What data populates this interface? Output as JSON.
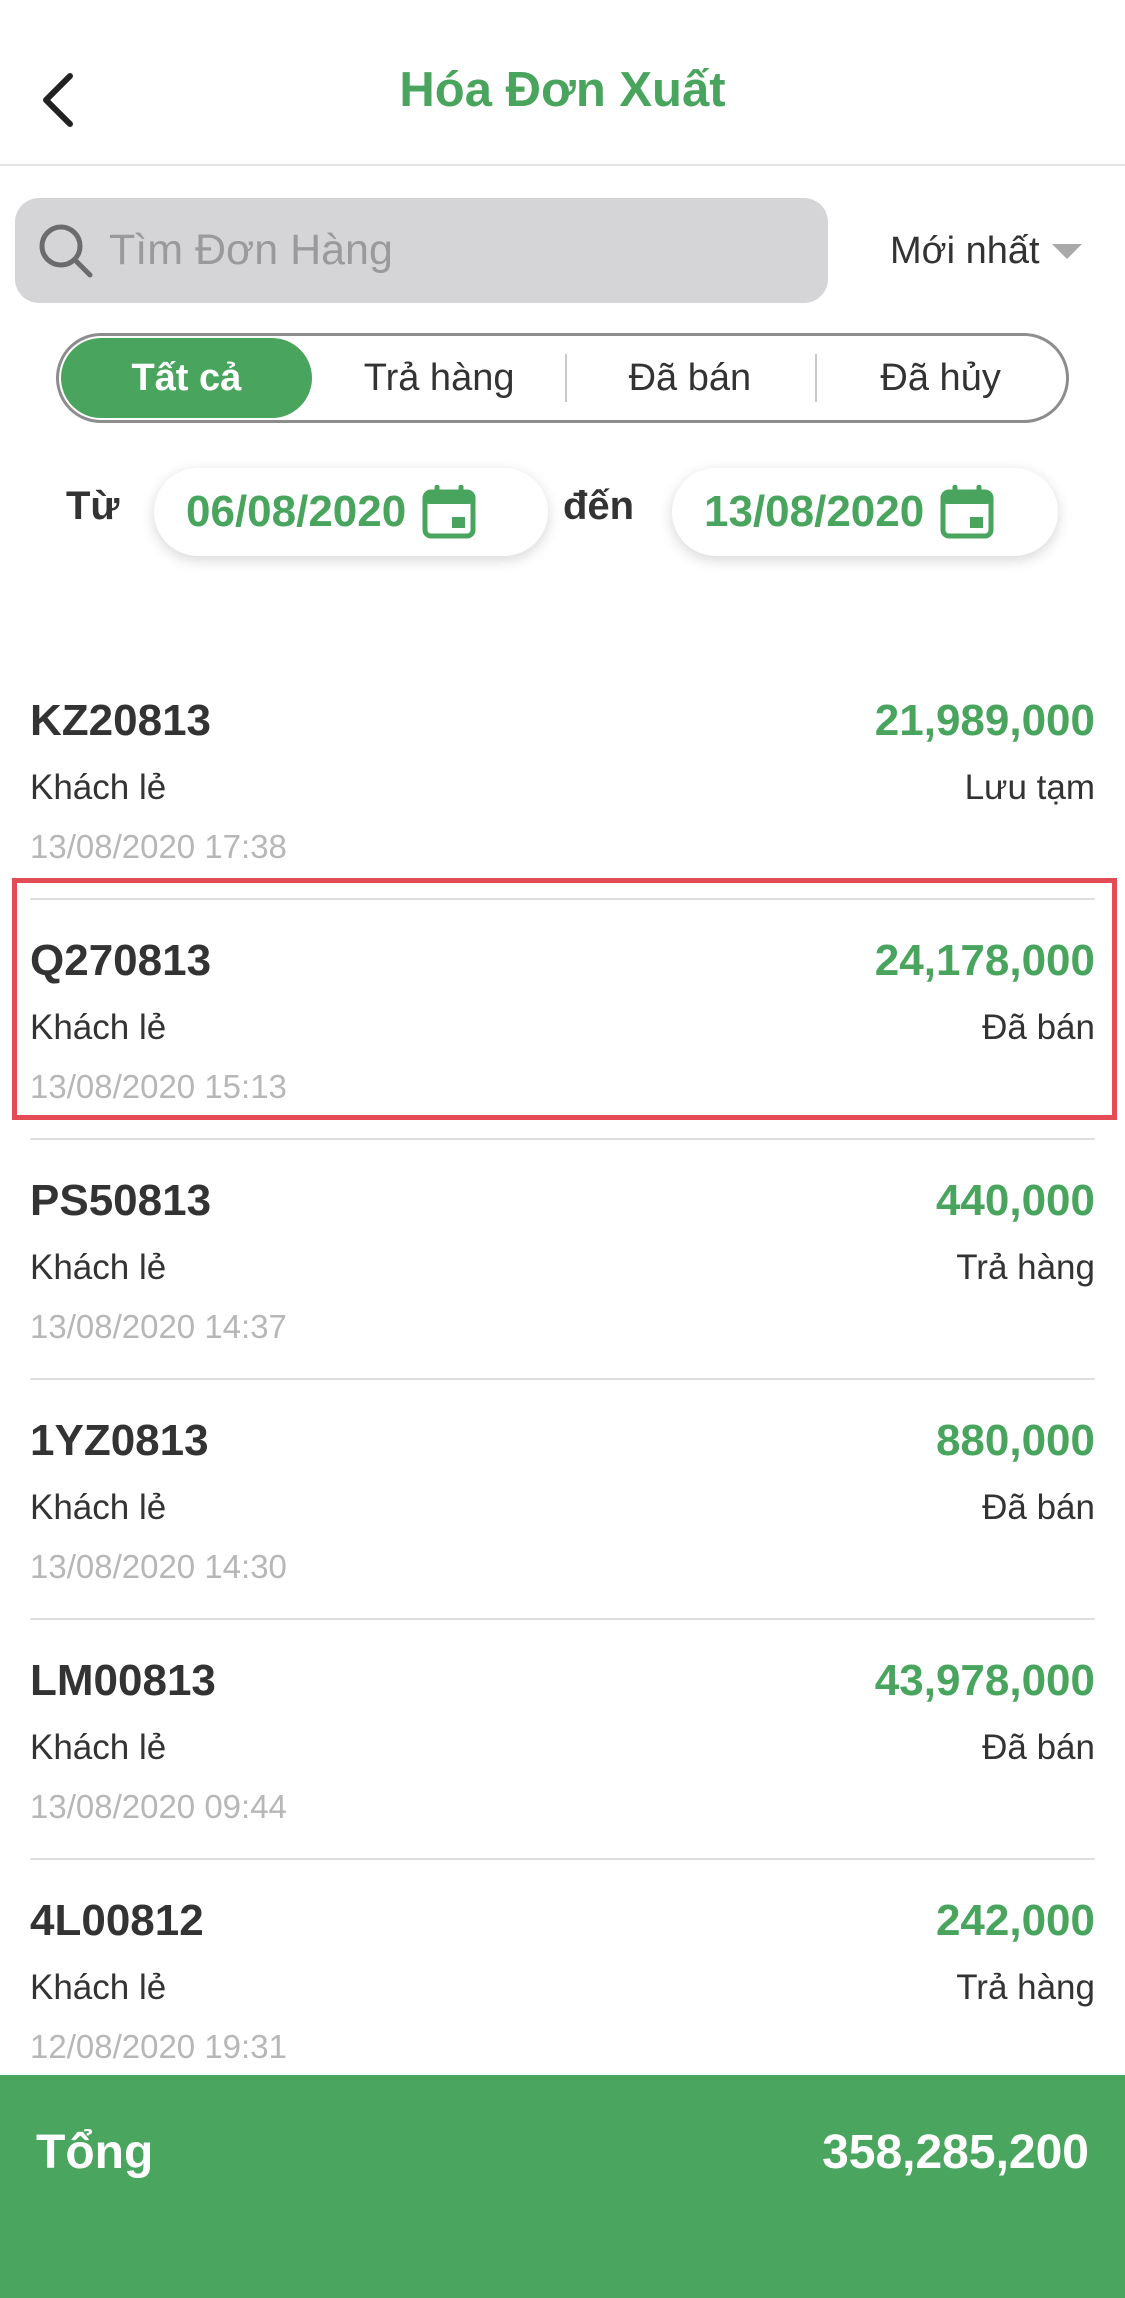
{
  "header": {
    "title": "Hóa Đơn Xuất"
  },
  "search": {
    "placeholder": "Tìm Đơn Hàng",
    "value": ""
  },
  "sort": {
    "label": "Mới nhất"
  },
  "tabs": [
    {
      "label": "Tất cả",
      "active": true
    },
    {
      "label": "Trả hàng",
      "active": false
    },
    {
      "label": "Đã bán",
      "active": false
    },
    {
      "label": "Đã hủy",
      "active": false
    }
  ],
  "date_filter": {
    "from_label": "Từ",
    "from": "06/08/2020",
    "to_label": "đến",
    "to": "13/08/2020"
  },
  "orders": [
    {
      "code": "KZ20813",
      "amount": "21,989,000",
      "customer": "Khách lẻ",
      "status": "Lưu tạm",
      "time": "13/08/2020 17:38"
    },
    {
      "code": "Q270813",
      "amount": "24,178,000",
      "customer": "Khách lẻ",
      "status": "Đã bán",
      "time": "13/08/2020 15:13"
    },
    {
      "code": "PS50813",
      "amount": "440,000",
      "customer": "Khách lẻ",
      "status": "Trả hàng",
      "time": "13/08/2020 14:37"
    },
    {
      "code": "1YZ0813",
      "amount": "880,000",
      "customer": "Khách lẻ",
      "status": "Đã bán",
      "time": "13/08/2020 14:30"
    },
    {
      "code": "LM00813",
      "amount": "43,978,000",
      "customer": "Khách lẻ",
      "status": "Đã bán",
      "time": "13/08/2020 09:44"
    },
    {
      "code": "4L00812",
      "amount": "242,000",
      "customer": "Khách lẻ",
      "status": "Trả hàng",
      "time": "12/08/2020 19:31"
    }
  ],
  "footer": {
    "total_label": "Tổng",
    "total_value": "358,285,200"
  },
  "colors": {
    "accent": "#49a55e",
    "highlight": "#e34c54",
    "muted": "#b7b7b7"
  },
  "icons": {
    "back": "chevron-left-icon",
    "search": "search-icon",
    "calendar": "calendar-icon",
    "sort": "caret-down-icon"
  }
}
